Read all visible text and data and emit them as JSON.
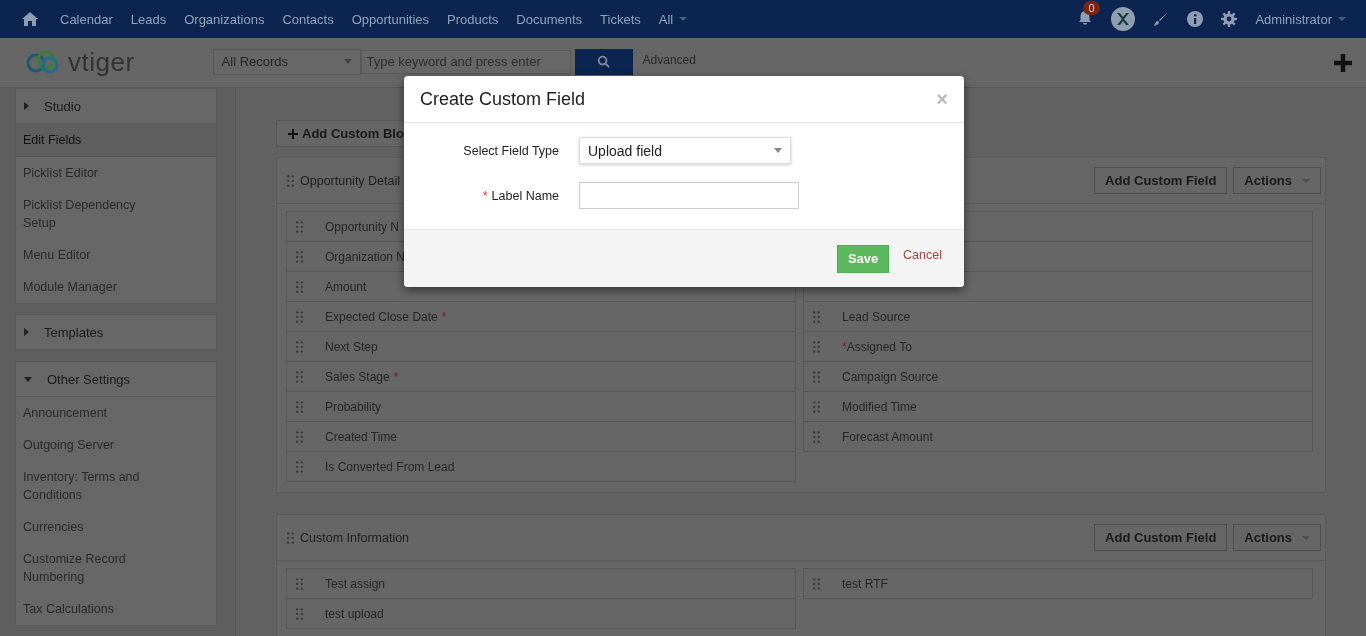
{
  "topnav": {
    "items": [
      {
        "label": "Calendar"
      },
      {
        "label": "Leads"
      },
      {
        "label": "Organizations"
      },
      {
        "label": "Contacts"
      },
      {
        "label": "Opportunities"
      },
      {
        "label": "Products"
      },
      {
        "label": "Documents"
      },
      {
        "label": "Tickets"
      },
      {
        "label": "All",
        "dropdown": true
      }
    ],
    "notification_count": "0",
    "user": "Administrator"
  },
  "logo": "vtiger",
  "searchbar": {
    "filter": "All Records",
    "placeholder": "Type keyword and press enter",
    "advanced": "Advanced"
  },
  "sidebar": {
    "sections": [
      {
        "title": "Studio",
        "expanded": false,
        "items": [
          {
            "label": "Edit Fields",
            "selected": true
          },
          {
            "label": "Picklist Editor",
            "selected": false
          },
          {
            "label": "Picklist Dependency Setup",
            "selected": false
          },
          {
            "label": "Menu Editor",
            "selected": false
          },
          {
            "label": "Module Manager",
            "selected": false
          }
        ]
      },
      {
        "title": "Templates",
        "expanded": false
      },
      {
        "title": "Other Settings",
        "expanded": true,
        "items": [
          {
            "label": "Announcement",
            "selected": false
          },
          {
            "label": "Outgoing Server",
            "selected": false
          },
          {
            "label": "Inventory: Terms and Conditions",
            "selected": false
          },
          {
            "label": "Currencies",
            "selected": false
          },
          {
            "label": "Customize Record Numbering",
            "selected": false
          },
          {
            "label": "Tax Calculations",
            "selected": false
          }
        ]
      }
    ]
  },
  "add_block_button": "Add Custom Blo",
  "blocks": [
    {
      "title": "Opportunity Detail",
      "add_button": "Add Custom Field",
      "actions_button": "Actions",
      "left_fields": [
        {
          "label": "Opportunity N"
        },
        {
          "label": "Organization N"
        },
        {
          "label": "Amount"
        },
        {
          "label": "Expected Close Date",
          "star_after": "*"
        },
        {
          "label": "Next Step"
        },
        {
          "label": "Sales Stage",
          "star_after": "*"
        },
        {
          "label": "Probability"
        },
        {
          "label": "Created Time"
        },
        {
          "label": "Is Converted From Lead"
        }
      ],
      "right_fields": [
        {
          "covered": true
        },
        {
          "covered": true
        },
        {
          "covered": true
        },
        {
          "label": "Lead Source"
        },
        {
          "label": "Assigned To",
          "star_before": "*"
        },
        {
          "label": "Campaign Source"
        },
        {
          "label": "Modified Time"
        },
        {
          "label": "Forecast Amount"
        }
      ]
    },
    {
      "title": "Custom Information",
      "add_button": "Add Custom Field",
      "actions_button": "Actions",
      "left_fields": [
        {
          "label": "Test assign"
        },
        {
          "label": "test upload"
        }
      ],
      "right_fields": [
        {
          "label": "test RTF"
        }
      ]
    }
  ],
  "modal": {
    "title": "Create Custom Field",
    "close": "×",
    "fields": [
      {
        "kind": "select",
        "label": "Select Field Type",
        "value": "Upload field"
      },
      {
        "kind": "text",
        "label": "Label Name",
        "required_mark": "*"
      }
    ],
    "save": "Save",
    "cancel": "Cancel"
  }
}
